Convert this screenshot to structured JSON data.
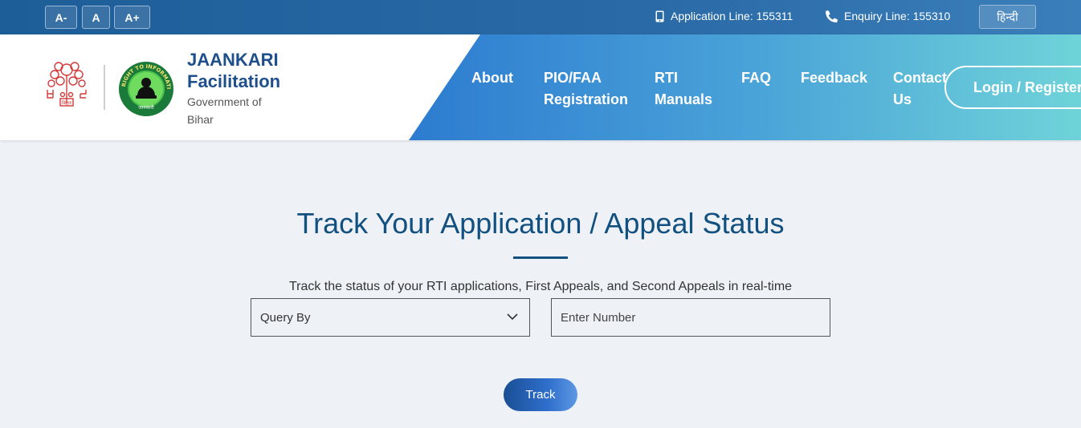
{
  "topbar": {
    "font_decrease": "A-",
    "font_normal": "A",
    "font_increase": "A+",
    "application_line": "Application Line: 155311",
    "enquiry_line": "Enquiry Line: 155310",
    "language_toggle": "हिन्दी"
  },
  "brand": {
    "title": "JAANKARI Facilitation",
    "subtitle": "Government of Bihar",
    "emblem_seal_text": "बिहार",
    "rti_logo_text": "RIGHT TO INFORMATION",
    "rti_logo_subtext": "जानकारी"
  },
  "nav": {
    "about": "About",
    "pio_faa": "PIO/FAA Registration",
    "rti_manuals": "RTI Manuals",
    "faq": "FAQ",
    "feedback": "Feedback",
    "contact": "Contact Us",
    "login": "Login / Register"
  },
  "main": {
    "title": "Track Your Application / Appeal Status",
    "subtitle": "Track the status of your RTI applications, First Appeals, and Second Appeals in real-time",
    "query_select": "Query By",
    "number_placeholder": "Enter Number",
    "track_button": "Track"
  },
  "colors": {
    "topbar": "#1d5d98",
    "brand_text": "#1e4f8a",
    "title": "#12507f",
    "page_bg": "#eef2f7"
  },
  "icons": {
    "application_line": "mobile-phone-icon",
    "enquiry_line": "phone-icon",
    "query_select": "chevron-down-icon"
  }
}
